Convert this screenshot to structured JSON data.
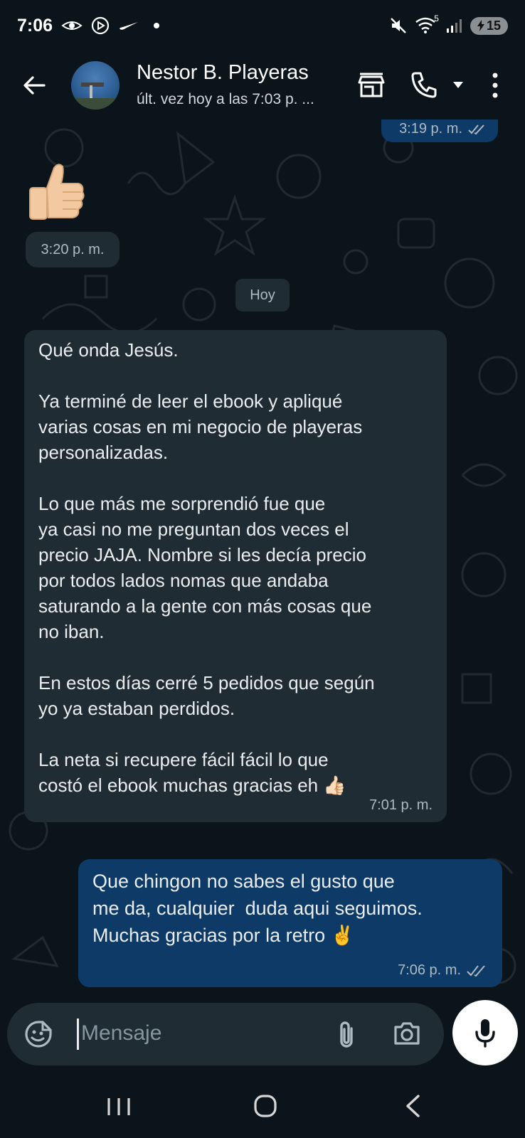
{
  "status_bar": {
    "time": "7:06",
    "signal_label": "5",
    "battery": "15"
  },
  "header": {
    "name": "Nestor B. Playeras",
    "status": "últ. vez hoy a las 7:03 p. ..."
  },
  "messages": [
    {
      "type": "outgoing-partial",
      "time": "3:19 p. m."
    },
    {
      "type": "incoming-sticker",
      "emoji": "👍🏻",
      "time": "3:20 p. m."
    },
    {
      "type": "date",
      "label": "Hoy"
    },
    {
      "type": "incoming",
      "text": "Qué onda Jesús.\n\nYa terminé de leer el ebook y apliqué\nvarias cosas en mi negocio de playeras\npersonalizadas.\n\nLo que más me sorprendió fue que\nya casi no me preguntan dos veces el\nprecio JAJA. Nombre si les decía precio\npor todos lados nomas que andaba\nsaturando a la gente con más cosas que\nno iban.\n\nEn estos días cerré 5 pedidos que según\nyo ya estaban perdidos.\n\nLa neta si recupere fácil fácil lo que\ncostó el ebook muchas gracias eh 👍🏻",
      "time": "7:01 p. m."
    },
    {
      "type": "outgoing",
      "text": "Que chingon no sabes el gusto que\nme da, cualquier  duda aqui seguimos.\nMuchas gracias por la retro ✌️",
      "time": "7:06 p. m."
    }
  ],
  "composer": {
    "placeholder": "Mensaje"
  },
  "colors": {
    "background": "#0b141a",
    "incoming_bubble": "#202c33",
    "outgoing_bubble": "#0d3a66",
    "meta_text": "#aebac1"
  }
}
